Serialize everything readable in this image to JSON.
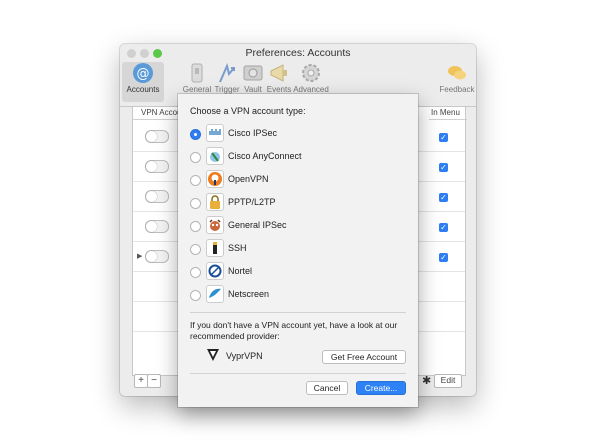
{
  "window": {
    "title": "Preferences: Accounts",
    "toolbar": [
      {
        "label": "Accounts",
        "icon": "at-sign-icon",
        "active": true
      },
      {
        "label": "General",
        "icon": "general-switch-icon"
      },
      {
        "label": "Trigger",
        "icon": "trigger-icon"
      },
      {
        "label": "Vault",
        "icon": "vault-safe-icon"
      },
      {
        "label": "Events",
        "icon": "megaphone-icon"
      },
      {
        "label": "Advanced",
        "icon": "gear-icon"
      },
      {
        "label": "Feedback",
        "icon": "speech-bubbles-icon"
      }
    ]
  },
  "table": {
    "headers": {
      "vpn_account": "VPN Accoun",
      "in_menu": "In Menu"
    },
    "rows": [
      {
        "in_menu": true
      },
      {
        "in_menu": true
      },
      {
        "in_menu": true
      },
      {
        "in_menu": true
      },
      {
        "in_menu": true
      }
    ]
  },
  "bottom": {
    "add_label": "+",
    "remove_label": "−",
    "edit_label": "Edit"
  },
  "sheet": {
    "title": "Choose a VPN account type:",
    "options": [
      {
        "label": "Cisco IPSec",
        "icon": "cisco-icon",
        "selected": true
      },
      {
        "label": "Cisco AnyConnect",
        "icon": "cisco-anyconnect-icon"
      },
      {
        "label": "OpenVPN",
        "icon": "openvpn-icon"
      },
      {
        "label": "PPTP/L2TP",
        "icon": "lock-icon"
      },
      {
        "label": "General IPSec",
        "icon": "ipsec-icon"
      },
      {
        "label": "SSH",
        "icon": "ssh-icon"
      },
      {
        "label": "Nortel",
        "icon": "nortel-icon"
      },
      {
        "label": "Netscreen",
        "icon": "netscreen-icon"
      }
    ],
    "note": "If you don't have a VPN account yet, have a look at our recommended provider:",
    "provider": {
      "name": "VyprVPN",
      "button": "Get Free Account"
    },
    "cancel": "Cancel",
    "create": "Create..."
  },
  "colors": {
    "accent": "#2d7ef3",
    "zoom_green": "#5cc84a"
  }
}
